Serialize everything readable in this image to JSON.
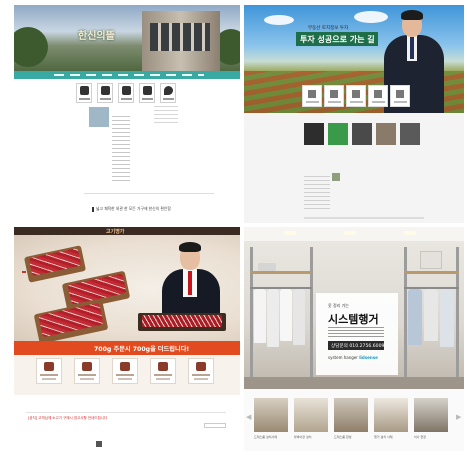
{
  "tiles": [
    {
      "name": "hanshin-pension-site",
      "logo_text": "한신의뜰",
      "caption": "넓고 쾌적한 외관 한 모든 가구에 한신의 편안함",
      "accent_color": "#39a9a4"
    },
    {
      "name": "investment-land-site",
      "headline_small": "부동산 토지정보 투자",
      "banner_text": "투자 성공으로 가는 길",
      "accent_color": "#1e6e4a"
    },
    {
      "name": "meat-shop-site",
      "logo_text": "고기명가",
      "promo_text": "700g 주문시 700g을 더드립니다!",
      "icon_labels": [
        "고객만족 쇼핑",
        "매장소개",
        "배송안내",
        "상품주문",
        "이벤트"
      ],
      "notice_text": "[공지] 고객님께 소고기 구매시 참고사항 안내드립니다",
      "accent_color": "#e24b1f"
    },
    {
      "name": "system-hanger-site",
      "sign_small": "옷 정리 가는",
      "sign_title": "시스템행거",
      "phone_text": "상담문의 010.2756.6009",
      "brand_prefix": "system hanger",
      "brand_suffix": "lidsense",
      "thumb_captions": [
        "드레스룸 설치사례",
        "붙박이장 설치",
        "드레스룸 완성",
        "행거 설치 사례",
        "이사 현장"
      ]
    }
  ]
}
